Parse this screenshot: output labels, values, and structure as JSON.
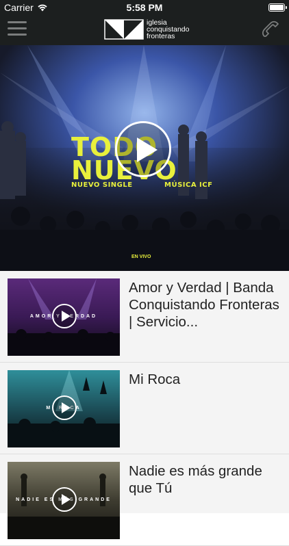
{
  "status": {
    "carrier": "Carrier",
    "time": "5:58 PM"
  },
  "header": {
    "logo_lines": [
      "iglesia",
      "conquistando",
      "fronteras"
    ]
  },
  "hero": {
    "title_line1": "TODO",
    "title_line2": "NUEVO",
    "sub_left": "NUEVO SINGLE",
    "sub_right": "MÚSICA ICF",
    "live": "EN VIVO"
  },
  "videos": [
    {
      "title": "Amor y Verdad | Banda Conquistando Fronteras | Servicio...",
      "thumb_text": "AMOR Y VERDAD"
    },
    {
      "title": "Mi Roca",
      "thumb_text": "MI ROCA"
    },
    {
      "title": "Nadie es más grande que Tú",
      "thumb_text": "NADIE ES MÁS GRANDE"
    }
  ],
  "colors": {
    "bar_bg": "#1c1f1f",
    "accent_yellow": "#e8f03c",
    "list_bg": "#f4f4f4"
  }
}
